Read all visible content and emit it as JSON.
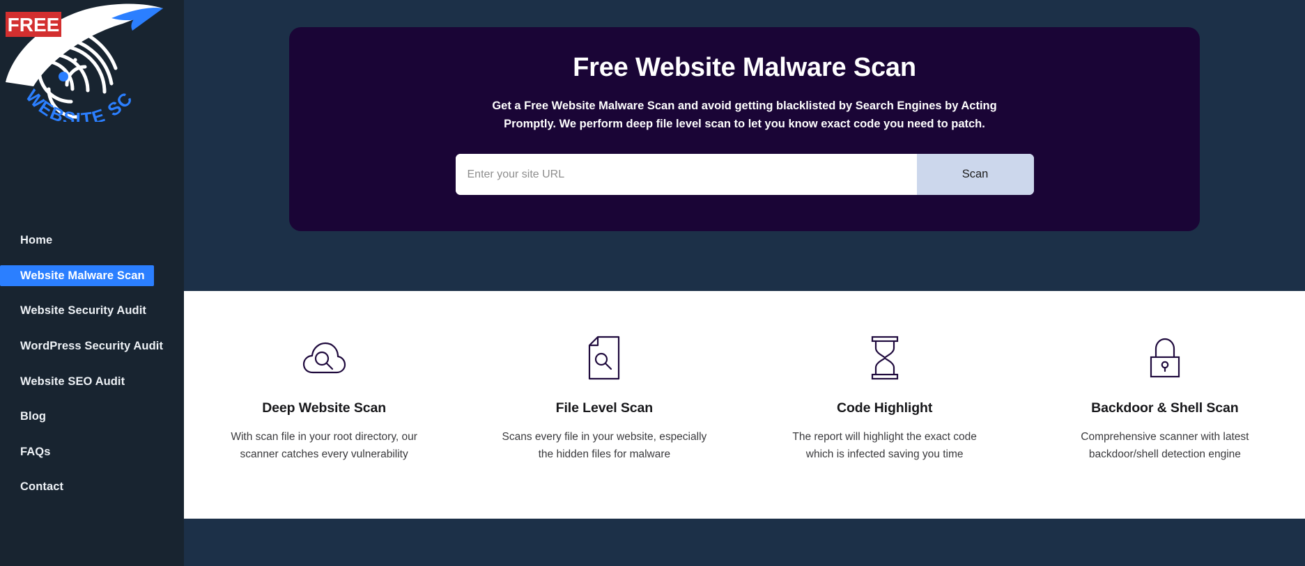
{
  "brand": {
    "free_badge": "FREE",
    "name_part1": "WEBSITE",
    "name_part2": "SCAN",
    "badge_color": "#d32f2f",
    "accent_blue": "#2b7fff"
  },
  "sidebar": {
    "background": "#182430",
    "active_color": "#2b7fff",
    "items": [
      {
        "label": "Home",
        "active": false
      },
      {
        "label": "Website Malware Scan",
        "active": true
      },
      {
        "label": "Website Security Audit",
        "active": false
      },
      {
        "label": "WordPress Security Audit",
        "active": false
      },
      {
        "label": "Website SEO Audit",
        "active": false
      },
      {
        "label": "Blog",
        "active": false
      },
      {
        "label": "FAQs",
        "active": false
      },
      {
        "label": "Contact",
        "active": false
      }
    ]
  },
  "hero": {
    "background": "#1a0536",
    "title": "Free Website Malware Scan",
    "subtitle": "Get a Free Website Malware Scan and avoid getting blacklisted by Search Engines by Acting Promptly. We perform deep file level scan to let you know exact code you need to patch.",
    "input_placeholder": "Enter your site URL",
    "input_value": "",
    "scan_button": "Scan",
    "scan_button_color": "#ccd7ec"
  },
  "features": {
    "icon_color": "#1f0a3d",
    "items": [
      {
        "icon": "cloud-search-icon",
        "title": "Deep Website Scan",
        "description": "With scan file in your root directory, our scanner catches every vulnerability"
      },
      {
        "icon": "file-search-icon",
        "title": "File Level Scan",
        "description": "Scans every file in your website, especially the hidden files for malware"
      },
      {
        "icon": "hourglass-icon",
        "title": "Code Highlight",
        "description": "The report will highlight the exact code which is infected saving you time"
      },
      {
        "icon": "padlock-icon",
        "title": "Backdoor & Shell Scan",
        "description": "Comprehensive scanner with latest backdoor/shell detection engine"
      }
    ]
  }
}
